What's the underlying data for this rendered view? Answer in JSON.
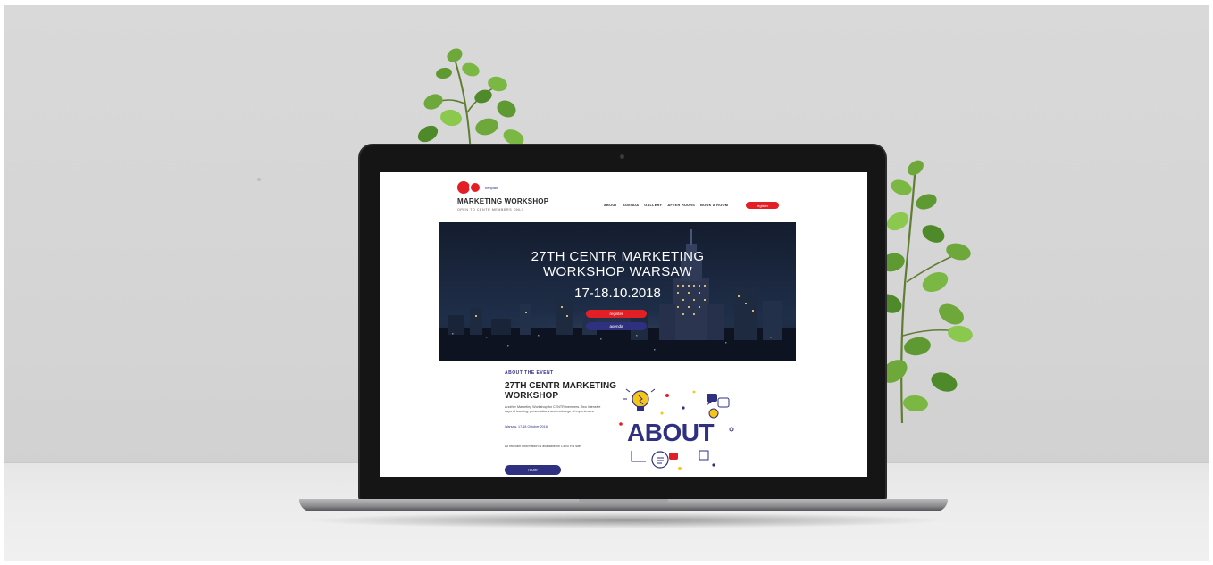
{
  "site": {
    "logo_tag": "nenplan",
    "title": "MARKETING WORKSHOP",
    "subtitle": "OPEN TO CENTR MEMBERS ONLY"
  },
  "nav": {
    "items": [
      "ABOUT",
      "AGENDA",
      "GALLERY",
      "AFTER HOURS",
      "BOOK A ROOM"
    ],
    "register_label": "register"
  },
  "hero": {
    "title_line1": "27TH CENTR MARKETING",
    "title_line2": "WORKSHOP WARSAW",
    "date": "17-18.10.2018",
    "register_label": "register",
    "agenda_label": "agenda"
  },
  "about": {
    "label": "ABOUT THE EVENT",
    "title_line1": "27TH CENTR MARKETING",
    "title_line2": "WORKSHOP",
    "description": "Another Marketing Workshop for CENTR members. Two intensive days of learning, presentations and exchange of experiences.",
    "date": "Warsaw, 17-18 October 2018",
    "info": "All relevant information is available on CENTR's site.",
    "more_label": "more",
    "art_word": "ABOUT"
  },
  "colors": {
    "accent_red": "#e31f26",
    "accent_navy": "#2f3080",
    "hero_bg": "#1b2840",
    "idea_yellow": "#f5c518"
  }
}
